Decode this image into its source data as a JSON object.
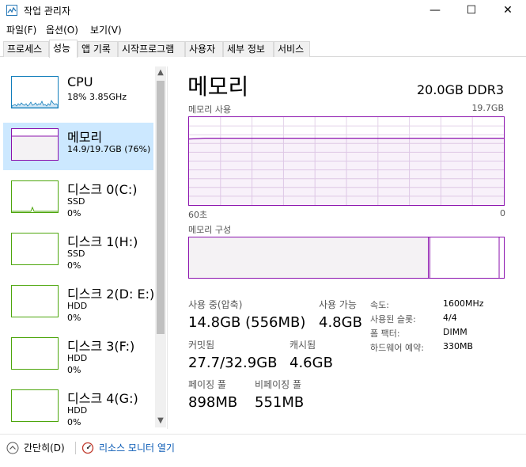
{
  "window": {
    "title": "작업 관리자",
    "minimize_glyph": "—",
    "maximize_glyph": "☐",
    "close_glyph": "✕"
  },
  "menu": [
    "파일(F)",
    "옵션(O)",
    "보기(V)"
  ],
  "tabs": [
    {
      "label": "프로세스",
      "active": false
    },
    {
      "label": "성능",
      "active": true
    },
    {
      "label": "앱 기록",
      "active": false
    },
    {
      "label": "시작프로그램",
      "active": false
    },
    {
      "label": "사용자",
      "active": false
    },
    {
      "label": "세부 정보",
      "active": false
    },
    {
      "label": "서비스",
      "active": false
    }
  ],
  "sidebar": {
    "items": [
      {
        "name": "CPU",
        "line1": "18% 3.85GHz",
        "line2": "",
        "color": "#117dbb",
        "kind": "cpu",
        "selected": false
      },
      {
        "name": "메모리",
        "line1": "14.9/19.7GB (76%)",
        "line2": "",
        "color": "#8b12ae",
        "kind": "mem",
        "selected": true
      },
      {
        "name": "디스크 0(C:)",
        "line1": "SSD",
        "line2": "0%",
        "color": "#4da60c",
        "kind": "disk-spike",
        "selected": false
      },
      {
        "name": "디스크 1(H:)",
        "line1": "SSD",
        "line2": "0%",
        "color": "#4da60c",
        "kind": "disk",
        "selected": false
      },
      {
        "name": "디스크 2(D: E:)",
        "line1": "HDD",
        "line2": "0%",
        "color": "#4da60c",
        "kind": "disk",
        "selected": false
      },
      {
        "name": "디스크 3(F:)",
        "line1": "HDD",
        "line2": "0%",
        "color": "#4da60c",
        "kind": "disk",
        "selected": false
      },
      {
        "name": "디스크 4(G:)",
        "line1": "HDD",
        "line2": "0%",
        "color": "#4da60c",
        "kind": "disk",
        "selected": false
      }
    ]
  },
  "main": {
    "title": "메모리",
    "spec": "20.0GB DDR3",
    "usage_label": "메모리 사용",
    "usage_max": "19.7GB",
    "time_left": "60초",
    "time_right": "0",
    "usage_fraction": 0.76,
    "composition_label": "메모리 구성",
    "composition": {
      "in_use_fraction": 0.76,
      "modified_fraction": 0.005,
      "standby_fraction": 0.22
    },
    "accent_color": "#8b12ae",
    "stats": {
      "in_use_label": "사용 중(압축)",
      "in_use_value": "14.8GB (556MB)",
      "available_label": "사용 가능",
      "available_value": "4.8GB",
      "committed_label": "커밋됨",
      "committed_value": "27.7/32.9GB",
      "cached_label": "캐시됨",
      "cached_value": "4.6GB",
      "paged_label": "페이징 풀",
      "paged_value": "898MB",
      "nonpaged_label": "비페이징 풀",
      "nonpaged_value": "551MB"
    },
    "details": {
      "speed_label": "속도:",
      "speed_value": "1600MHz",
      "slots_label": "사용된 슬롯:",
      "slots_value": "4/4",
      "form_label": "폼 팩터:",
      "form_value": "DIMM",
      "reserved_label": "하드웨어 예약:",
      "reserved_value": "330MB"
    }
  },
  "footer": {
    "fewer_details": "간단히(D)",
    "resource_monitor": "리소스 모니터 열기"
  }
}
